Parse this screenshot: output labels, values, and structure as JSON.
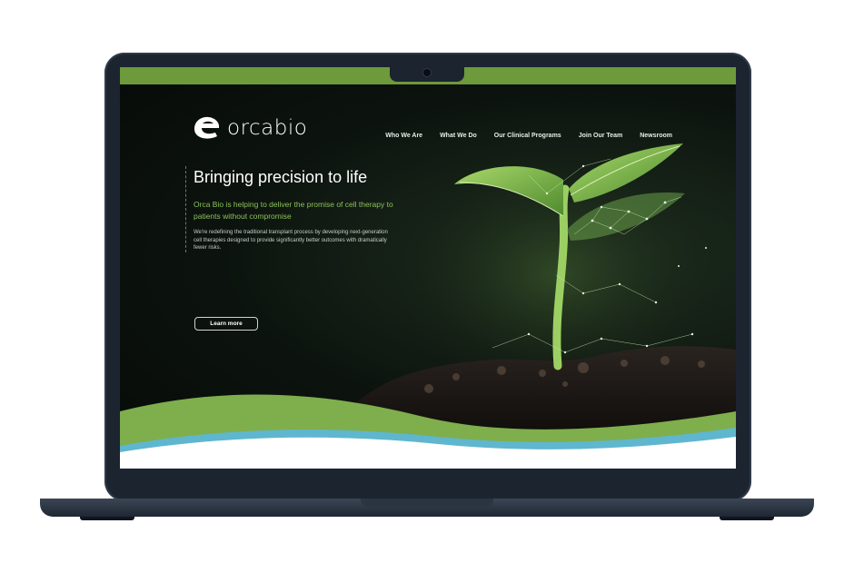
{
  "logo": {
    "text_main": "orca",
    "text_accent": "bio"
  },
  "nav": {
    "items": [
      {
        "label": "Who We Are"
      },
      {
        "label": "What We Do"
      },
      {
        "label": "Our Clinical Programs"
      },
      {
        "label": "Join Our Team"
      },
      {
        "label": "Newsroom"
      }
    ]
  },
  "hero": {
    "headline": "Bringing precision to life",
    "subheadline": "Orca Bio is helping to deliver the promise of cell therapy to patients without compromise",
    "body": "We're redefining the traditional transplant process by developing next-generation cell therapies designed to provide significantly better outcomes with dramatically fewer risks.",
    "cta_label": "Learn more"
  },
  "colors": {
    "brand_green": "#6d9a3b",
    "accent_green": "#8cc05a",
    "wave_blue": "#5fb6cf",
    "background": "#0b100d"
  },
  "icons": [
    "orca-logo-mark",
    "camera"
  ]
}
